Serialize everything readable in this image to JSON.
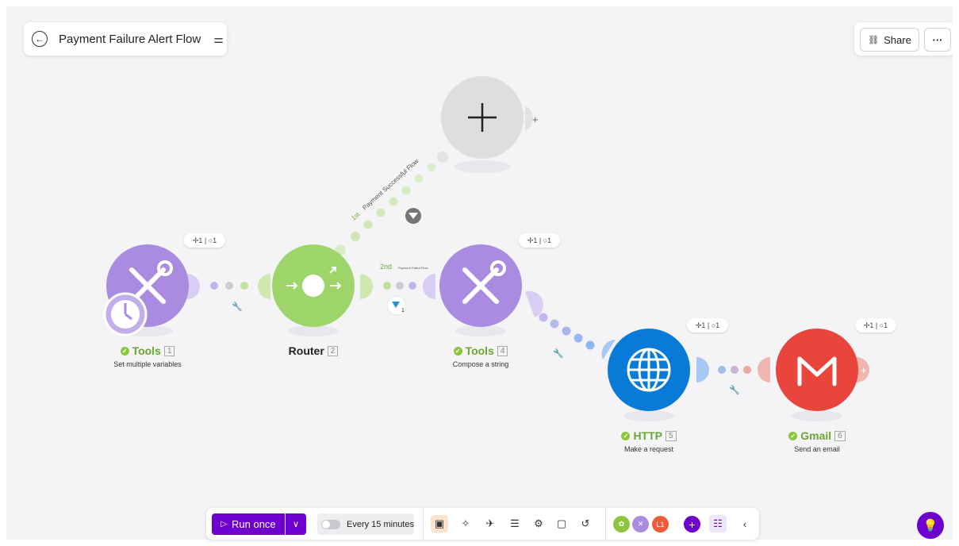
{
  "header": {
    "title": "Payment Failure Alert Flow"
  },
  "actions": {
    "share_label": "Share",
    "more_label": "···"
  },
  "nodes": [
    {
      "name": "Tools",
      "number": "1",
      "desc": "Set multiple variables",
      "badge": "✢1 | ○1",
      "color": "#a98be0",
      "icon": "tools-icon"
    },
    {
      "name": "Router",
      "number": "2",
      "desc": "",
      "badge": "",
      "color": "#9ed56a",
      "icon": "router-icon"
    },
    {
      "name": "Tools",
      "number": "4",
      "desc": "Compose a string",
      "badge": "✢1 | ○1",
      "color": "#a98be0",
      "icon": "tools-icon"
    },
    {
      "name": "HTTP",
      "number": "5",
      "desc": "Make a request",
      "badge": "✢1 | ○1",
      "color": "#0a7ad8",
      "icon": "globe-icon"
    },
    {
      "name": "Gmail",
      "number": "6",
      "desc": "Send an email",
      "badge": "✢1 | ○1",
      "color": "#e8453c",
      "icon": "gmail-icon"
    }
  ],
  "routes": [
    {
      "order": "1st",
      "label": "Payment Successful Flow"
    },
    {
      "order": "2nd",
      "label": "Payment Failed Flow"
    }
  ],
  "filter_count": "1",
  "toolbar": {
    "run_label": "Run once",
    "schedule_label": "Every 15 minutes",
    "avatar_label": "L1"
  },
  "colors": {
    "accent": "#6d00cc",
    "success": "#8cc63f"
  }
}
